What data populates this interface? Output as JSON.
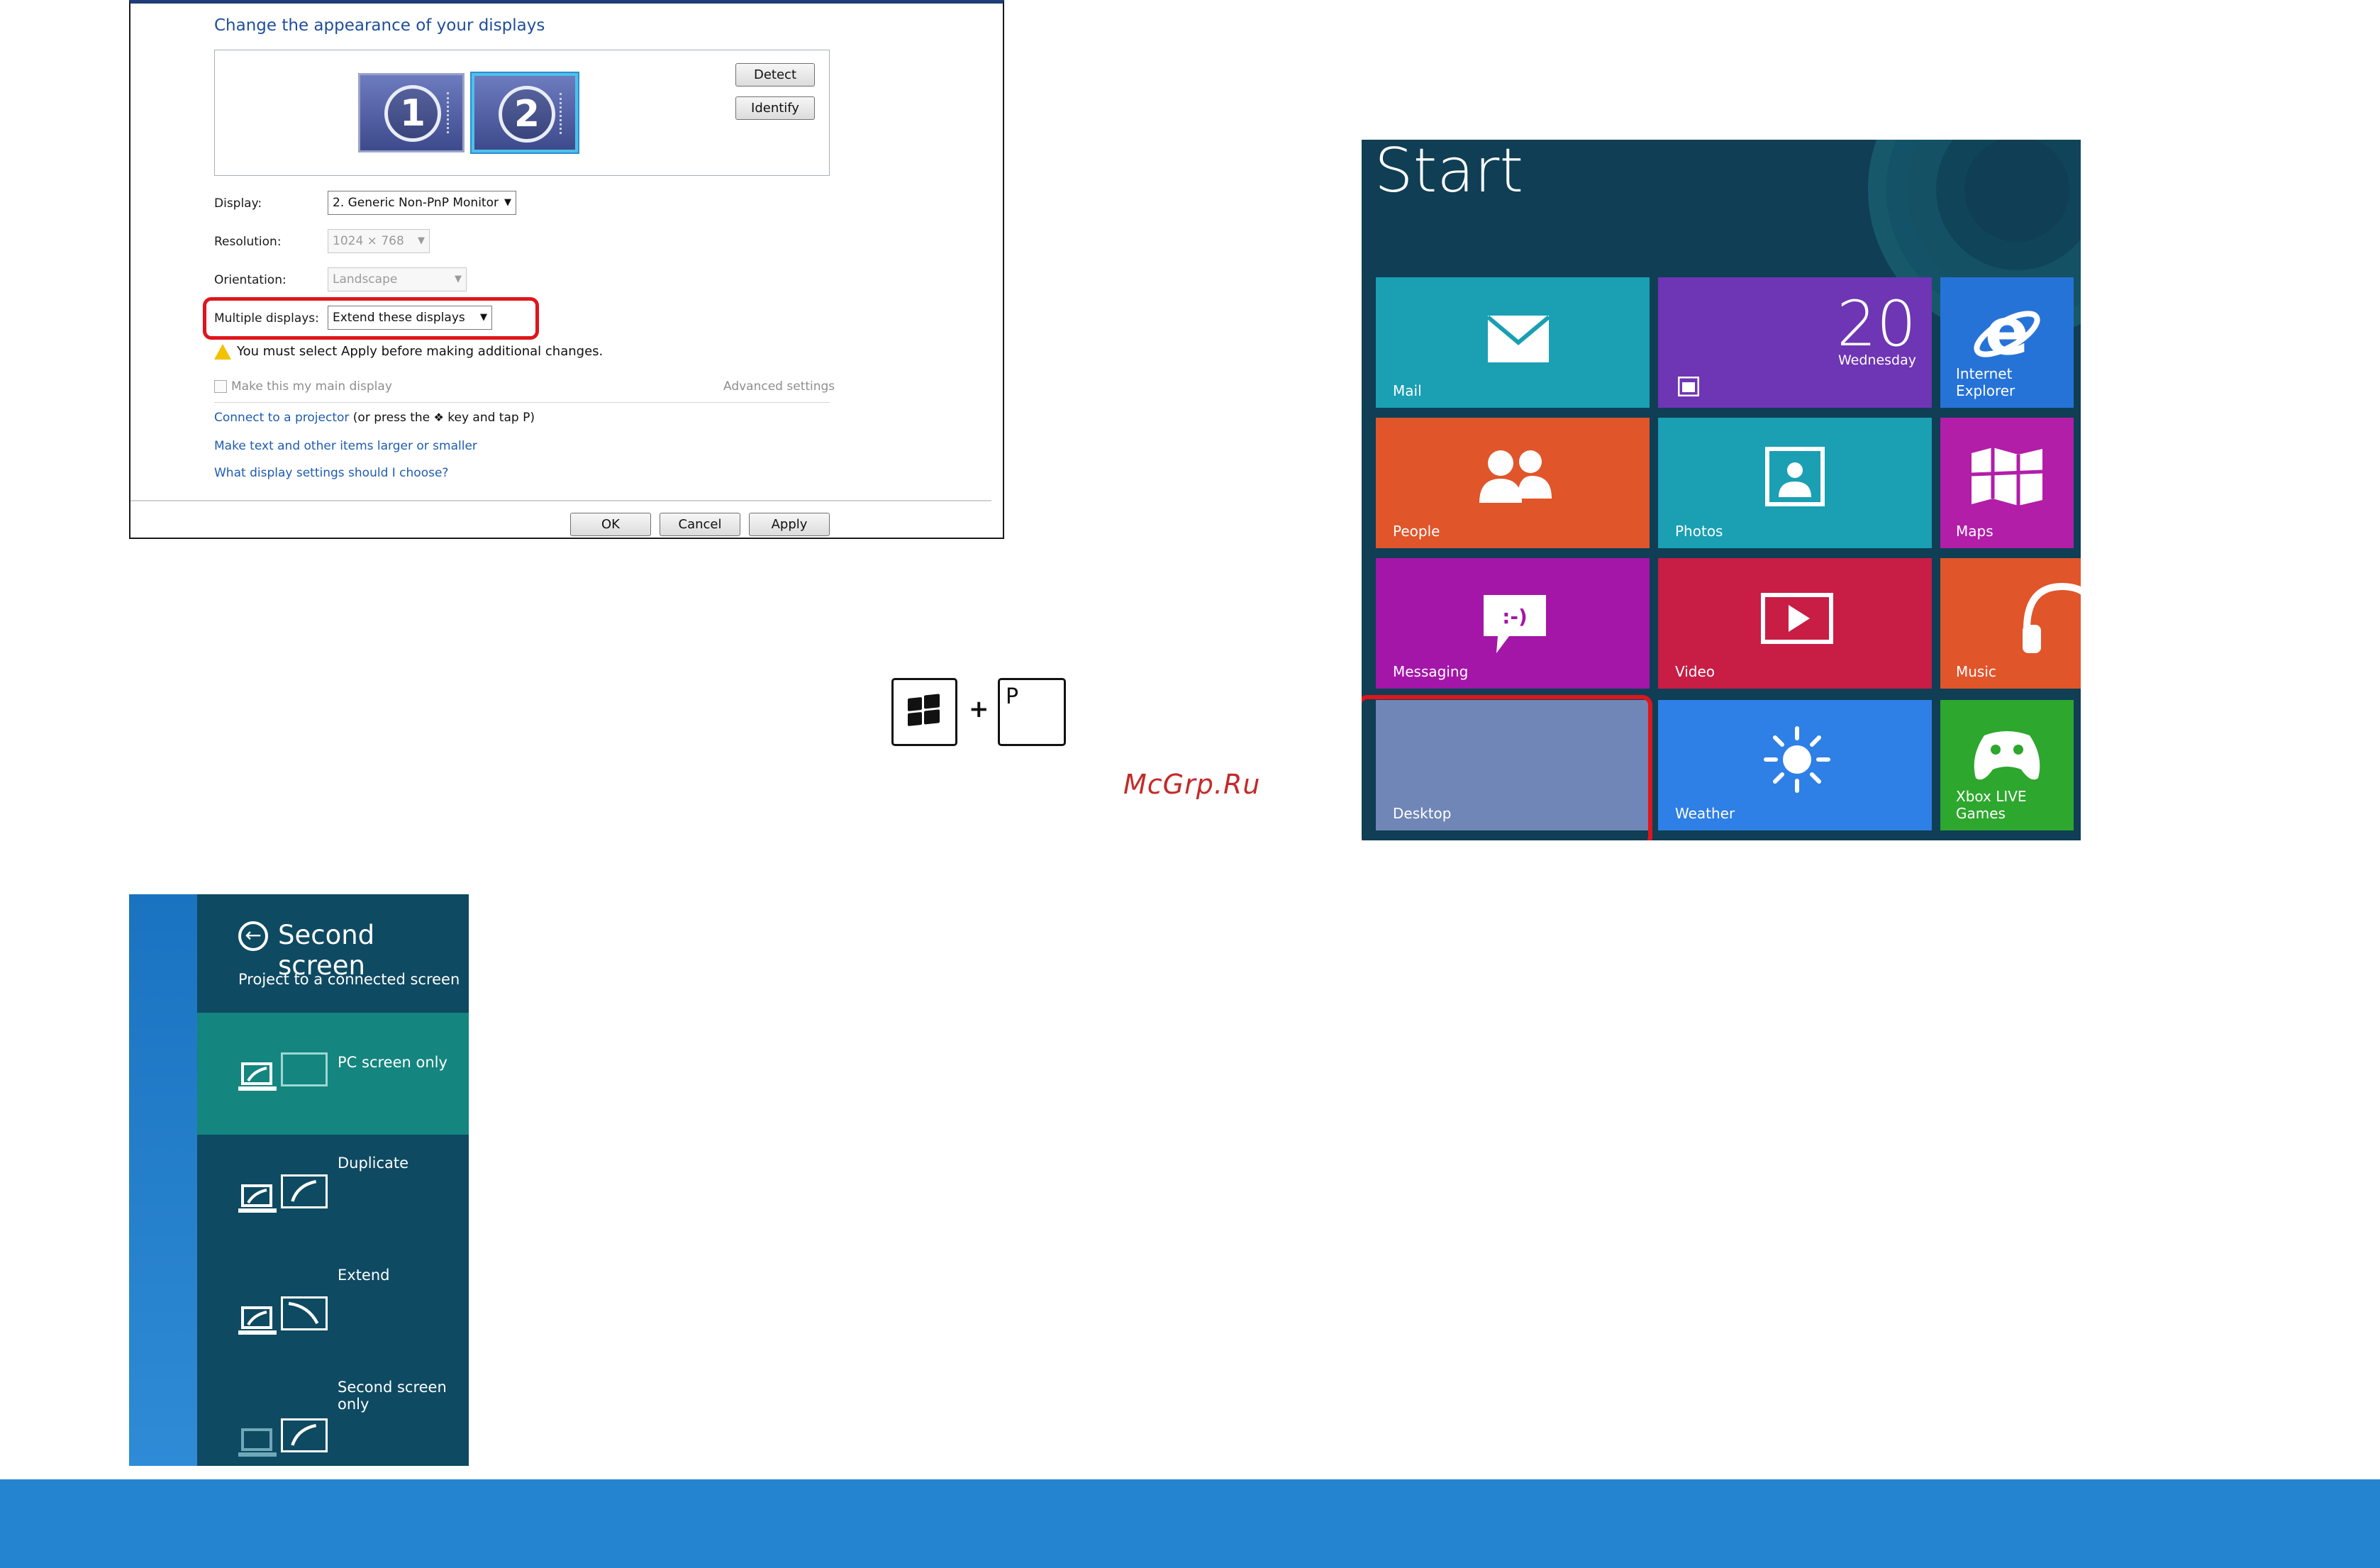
{
  "display_settings": {
    "heading": "Change the appearance of your displays",
    "monitor_1": "1",
    "monitor_2": "2",
    "detect_label": "Detect",
    "identify_label": "Identify",
    "display_label": "Display:",
    "display_value": "2. Generic Non-PnP Monitor",
    "resolution_label": "Resolution:",
    "resolution_value": "1024 × 768",
    "orientation_label": "Orientation:",
    "orientation_value": "Landscape",
    "multiple_label": "Multiple displays:",
    "multiple_value": "Extend these displays",
    "warning_text": "You must select Apply before making additional changes.",
    "main_display_label": "Make this my main display",
    "advanced_label": "Advanced settings",
    "projector_link": "Connect to a projector",
    "projector_suffix_1": " (or press the ",
    "projector_suffix_2": " key and tap P)",
    "text_size_link": "Make text and other items larger or smaller",
    "help_link": "What display settings should I choose?",
    "ok_label": "OK",
    "cancel_label": "Cancel",
    "apply_label": "Apply"
  },
  "shortcut": {
    "plus": "+",
    "key_p": "P"
  },
  "watermark": "McGrp.Ru",
  "start_screen": {
    "title": "Start",
    "calendar_day": "20",
    "calendar_weekday": "Wednesday",
    "tiles": {
      "mail": "Mail",
      "calendar": "",
      "internet_explorer": "Internet Explorer",
      "people": "People",
      "photos": "Photos",
      "maps": "Maps",
      "messaging": "Messaging",
      "video": "Video",
      "music": "Music",
      "desktop": "Desktop",
      "weather": "Weather",
      "xbox": "Xbox LIVE Games"
    },
    "messaging_glyph": ":-)"
  },
  "second_screen": {
    "title": "Second screen",
    "subtitle": "Project to a connected screen",
    "options": [
      "PC screen only",
      "Duplicate",
      "Extend",
      "Second screen only"
    ],
    "selected": "PC screen only"
  },
  "colors": {
    "mail": "#1a9fb3",
    "calendar": "#6e35b4",
    "ie": "#2673d8",
    "people": "#e0552a",
    "photos": "#1a9fb3",
    "maps": "#b21ea8",
    "messaging": "#a416a8",
    "video": "#c81d45",
    "music": "#e0552a",
    "desktop": "#6f86b6",
    "weather": "#2e7fe6",
    "xbox": "#2da72d",
    "footer": "#2584cf"
  }
}
